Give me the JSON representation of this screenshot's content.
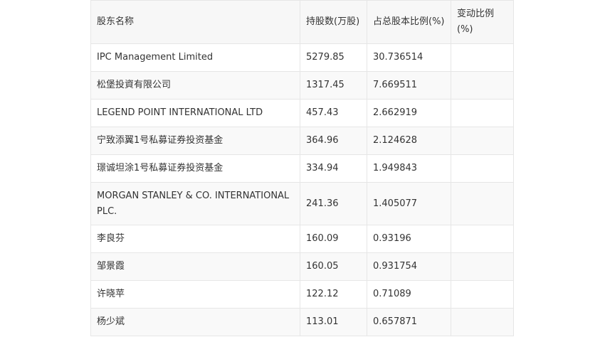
{
  "table": {
    "headers": [
      "股东名称",
      "持股数(万股)",
      "占总股本比例(%)",
      "变动比例(%)"
    ],
    "rows": [
      {
        "name": "IPC Management Limited",
        "shares": "5279.85",
        "ratio": "30.736514",
        "change": ""
      },
      {
        "name": "松堡投資有限公司",
        "shares": "1317.45",
        "ratio": "7.669511",
        "change": ""
      },
      {
        "name": "LEGEND POINT INTERNATIONAL LTD",
        "shares": "457.43",
        "ratio": "2.662919",
        "change": ""
      },
      {
        "name": "宁致添翼1号私募证券投资基金",
        "shares": "364.96",
        "ratio": "2.124628",
        "change": ""
      },
      {
        "name": "璟诚坦涂1号私募证券投资基金",
        "shares": "334.94",
        "ratio": "1.949843",
        "change": ""
      },
      {
        "name": "MORGAN STANLEY & CO. INTERNATIONAL PLC.",
        "shares": "241.36",
        "ratio": "1.405077",
        "change": ""
      },
      {
        "name": "李良芬",
        "shares": "160.09",
        "ratio": "0.93196",
        "change": ""
      },
      {
        "name": "邹景霞",
        "shares": "160.05",
        "ratio": "0.931754",
        "change": ""
      },
      {
        "name": "许晓苹",
        "shares": "122.12",
        "ratio": "0.71089",
        "change": ""
      },
      {
        "name": "杨少斌",
        "shares": "113.01",
        "ratio": "0.657871",
        "change": ""
      }
    ]
  }
}
